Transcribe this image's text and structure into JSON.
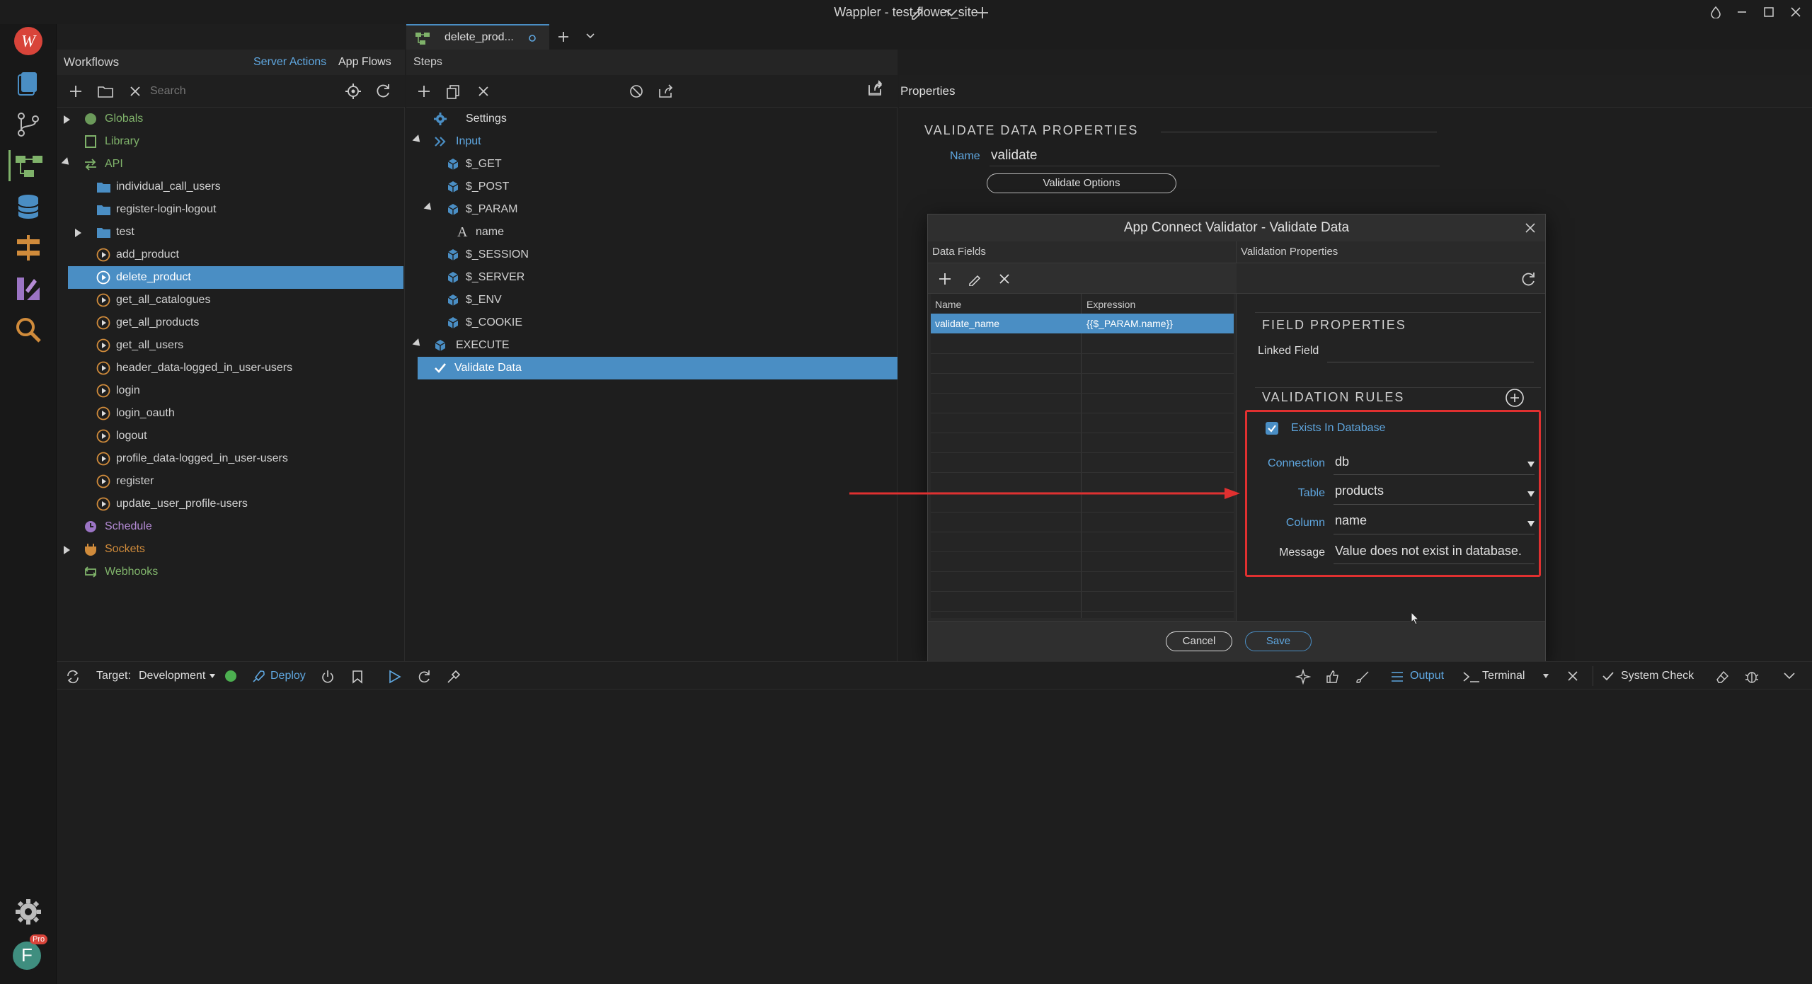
{
  "app": {
    "window_title": "Wappler - test-flower_site",
    "accent": "#4a8ec4",
    "avatar_letter": "F",
    "pro_badge": "Pro"
  },
  "left_panel": {
    "title": "Workflows",
    "tabs": [
      "Server Actions",
      "App Flows"
    ],
    "search_placeholder": "Search",
    "tree": [
      {
        "label": "Globals"
      },
      {
        "label": "Library"
      },
      {
        "label": "API"
      },
      {
        "label": "individual_call_users"
      },
      {
        "label": "register-login-logout"
      },
      {
        "label": "test"
      },
      {
        "label": "add_product"
      },
      {
        "label": "delete_product"
      },
      {
        "label": "get_all_catalogues"
      },
      {
        "label": "get_all_products"
      },
      {
        "label": "get_all_users"
      },
      {
        "label": "header_data-logged_in_user-users"
      },
      {
        "label": "login"
      },
      {
        "label": "login_oauth"
      },
      {
        "label": "logout"
      },
      {
        "label": "profile_data-logged_in_user-users"
      },
      {
        "label": "register"
      },
      {
        "label": "update_user_profile-users"
      },
      {
        "label": "Schedule"
      },
      {
        "label": "Sockets"
      },
      {
        "label": "Webhooks"
      }
    ]
  },
  "editor_tab": {
    "label": "delete_prod..."
  },
  "steps_panel": {
    "title": "Steps",
    "tree": [
      {
        "label": "Settings"
      },
      {
        "label": "Input"
      },
      {
        "label": "$_GET"
      },
      {
        "label": "$_POST"
      },
      {
        "label": "$_PARAM"
      },
      {
        "label": "name"
      },
      {
        "label": "$_SESSION"
      },
      {
        "label": "$_SERVER"
      },
      {
        "label": "$_ENV"
      },
      {
        "label": "$_COOKIE"
      },
      {
        "label": "EXECUTE"
      },
      {
        "label": "Validate Data"
      }
    ]
  },
  "properties_panel": {
    "title": "Properties",
    "section": "VALIDATE DATA PROPERTIES",
    "name_label": "Name",
    "name_value": "validate",
    "options_button": "Validate Options"
  },
  "dialog": {
    "title": "App Connect Validator - Validate Data",
    "data_fields_title": "Data Fields",
    "validation_properties_title": "Validation Properties",
    "columns": [
      "Name",
      "Expression"
    ],
    "rows": [
      {
        "name": "validate_name",
        "expression": "{{$_PARAM.name}}"
      }
    ],
    "field_properties": "FIELD PROPERTIES",
    "linked_field_label": "Linked Field",
    "linked_field_value": "",
    "validation_rules": "VALIDATION RULES",
    "rule": {
      "checkbox_label": "Exists In Database",
      "checked": true,
      "connection_label": "Connection",
      "connection_value": "db",
      "table_label": "Table",
      "table_value": "products",
      "column_label": "Column",
      "column_value": "name",
      "message_label": "Message",
      "message_value": "Value does not exist in database."
    },
    "cancel": "Cancel",
    "save": "Save",
    "highlight_color": "#e03030"
  },
  "bottom_bar": {
    "target_label": "Target:",
    "target_value": "Development",
    "status_color": "#4caf50",
    "deploy": "Deploy",
    "output": "Output",
    "terminal": "Terminal",
    "system_check": "System Check"
  }
}
